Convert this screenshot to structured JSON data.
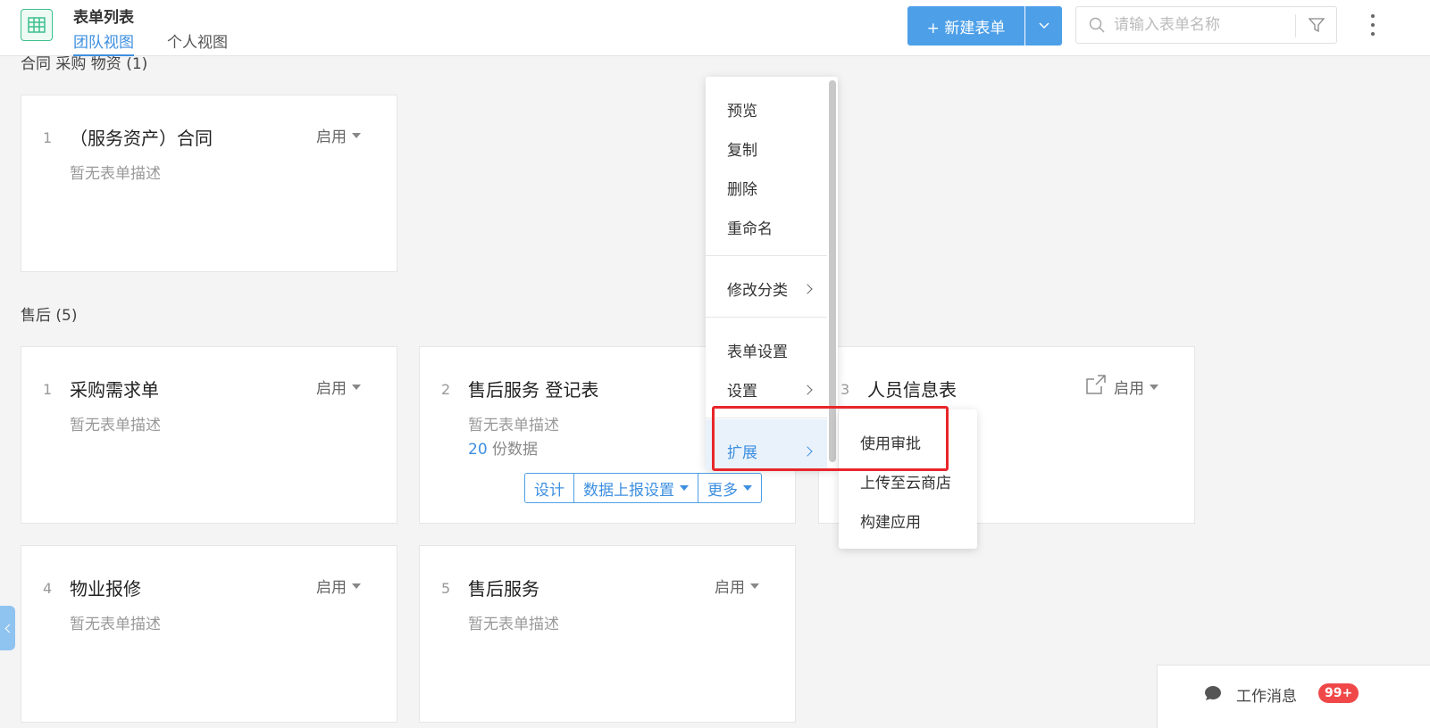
{
  "header": {
    "title": "表单列表",
    "tabs": [
      {
        "label": "团队视图",
        "active": true
      },
      {
        "label": "个人视图",
        "active": false
      }
    ],
    "new_button_label": "+ 新建表单",
    "search_placeholder": "请输入表单名称"
  },
  "sections": [
    {
      "label": "合同 采购 物资 (1)"
    },
    {
      "label": "售后 (5)"
    }
  ],
  "cards": {
    "contract": {
      "num": "1",
      "title": "（服务资产）合同",
      "desc": "暂无表单描述",
      "status": "启用"
    },
    "aftersale": [
      {
        "num": "1",
        "title": "采购需求单",
        "desc": "暂无表单描述",
        "status": "启用"
      },
      {
        "num": "2",
        "title": "售后服务 登记表",
        "desc": "暂无表单描述",
        "data_count": "20",
        "data_suffix": " 份数据"
      },
      {
        "num": "3",
        "title": "人员信息表",
        "status": "启用"
      },
      {
        "num": "4",
        "title": "物业报修",
        "desc": "暂无表单描述",
        "status": "启用"
      },
      {
        "num": "5",
        "title": "售后服务",
        "desc": "暂无表单描述",
        "status": "启用"
      }
    ],
    "actions": {
      "design": "设计",
      "report": "数据上报设置",
      "more": "更多"
    }
  },
  "menu": {
    "items": [
      "预览",
      "复制",
      "删除",
      "重命名",
      "修改分类",
      "表单设置",
      "设置",
      "扩展"
    ]
  },
  "submenu": {
    "items": [
      "使用审批",
      "上传至云商店",
      "构建应用"
    ]
  },
  "work_message": {
    "label": "工作消息",
    "badge": "99+"
  },
  "colors": {
    "accent": "#4d9fe8",
    "badge": "#f04848",
    "highlight_border": "#e8262a"
  }
}
